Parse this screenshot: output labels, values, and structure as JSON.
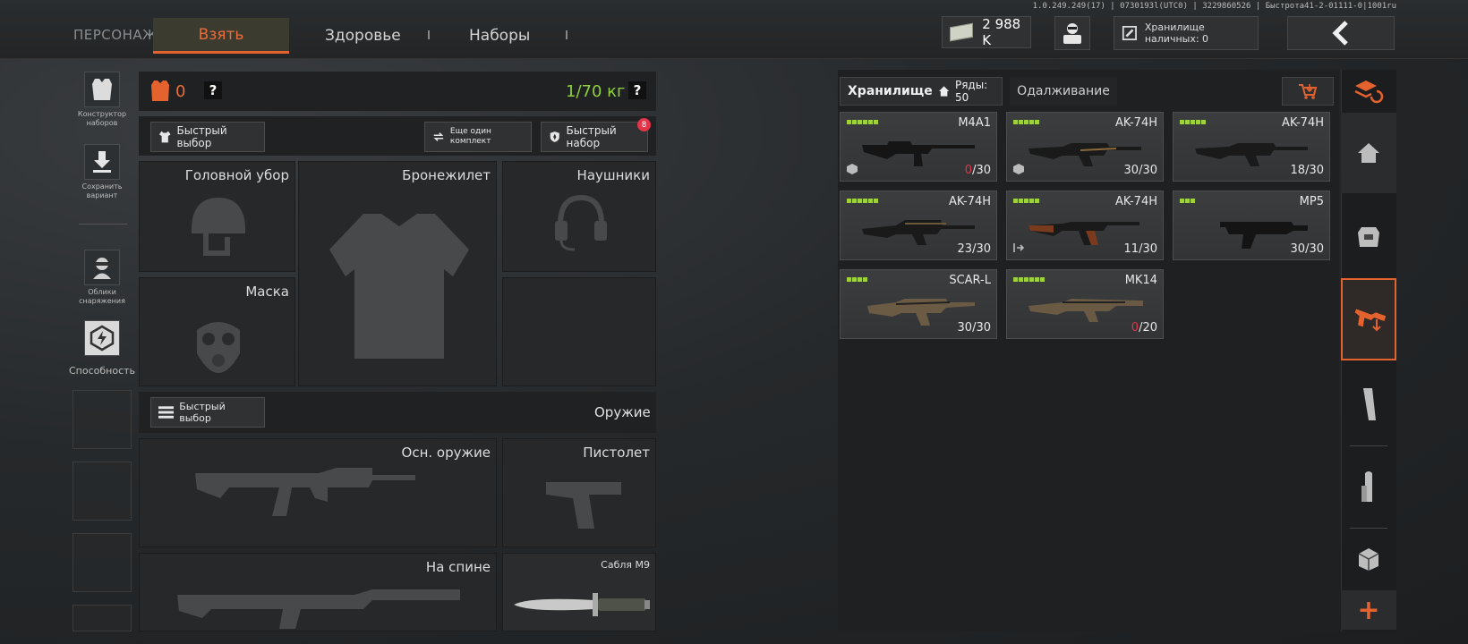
{
  "build_info": "1.0.249.249(17) | 0730193l(UTC0) | 3229860526 | Быстрота41-2-01111-0|1001ru",
  "tabs": {
    "character": "ПЕРСОНАЖ",
    "take": "Взять",
    "health": "Здоровье",
    "kits": "Наборы"
  },
  "cash": {
    "amount": "2 988 K"
  },
  "cash_storage": {
    "label": "Хранилище наличных: 0"
  },
  "sidebar": {
    "kit_builder": "Конструктор наборов",
    "save_variant": "Сохранить вариант",
    "gear_skins": "Облики снаряжения",
    "ability": "Способность"
  },
  "gear": {
    "armor_count": "0",
    "help": "?",
    "weight": "1/70 кг",
    "quick_pick": "Быстрый выбор",
    "another_kit": "Еще один комплект",
    "quick_kit": "Быстрый набор",
    "quick_kit_badge": "8",
    "slots": {
      "headwear": "Головной убор",
      "vest": "Бронежилет",
      "headphones": "Наушники",
      "mask": "Маска"
    }
  },
  "weapons": {
    "quick_pick": "Быстрый выбор",
    "section_title": "Оружие",
    "primary": "Осн. оружие",
    "pistol": "Пистолет",
    "back": "На спине",
    "melee": "Сабля M9"
  },
  "storage": {
    "tab_storage": "Хранилище",
    "rows_label": "Ряды: 50",
    "tab_lending": "Одалживание",
    "items": [
      {
        "name": "M4A1",
        "ammo_current": "0",
        "ammo_total": "/30",
        "empty": true,
        "rarity": 6,
        "tag": "box"
      },
      {
        "name": "AK-74H",
        "ammo_current": "30",
        "ammo_total": "/30",
        "empty": false,
        "rarity": 5,
        "tag": "box"
      },
      {
        "name": "AK-74H",
        "ammo_current": "18",
        "ammo_total": "/30",
        "empty": false,
        "rarity": 5,
        "tag": ""
      },
      {
        "name": "AK-74H",
        "ammo_current": "23",
        "ammo_total": "/30",
        "empty": false,
        "rarity": 6,
        "tag": ""
      },
      {
        "name": "AK-74H",
        "ammo_current": "11",
        "ammo_total": "/30",
        "empty": false,
        "rarity": 5,
        "tag": "arrow"
      },
      {
        "name": "MP5",
        "ammo_current": "30",
        "ammo_total": "/30",
        "empty": false,
        "rarity": 3,
        "tag": ""
      },
      {
        "name": "SCAR-L",
        "ammo_current": "30",
        "ammo_total": "/30",
        "empty": false,
        "rarity": 4,
        "tag": ""
      },
      {
        "name": "MK14",
        "ammo_current": "0",
        "ammo_total": "/20",
        "empty": true,
        "rarity": 6,
        "tag": ""
      }
    ]
  },
  "rail": {
    "add": "+"
  },
  "colors": {
    "accent": "#e4622e",
    "rarity": "#9ed13a",
    "weight": "#8fd13a",
    "empty_ammo": "#e3344a"
  }
}
